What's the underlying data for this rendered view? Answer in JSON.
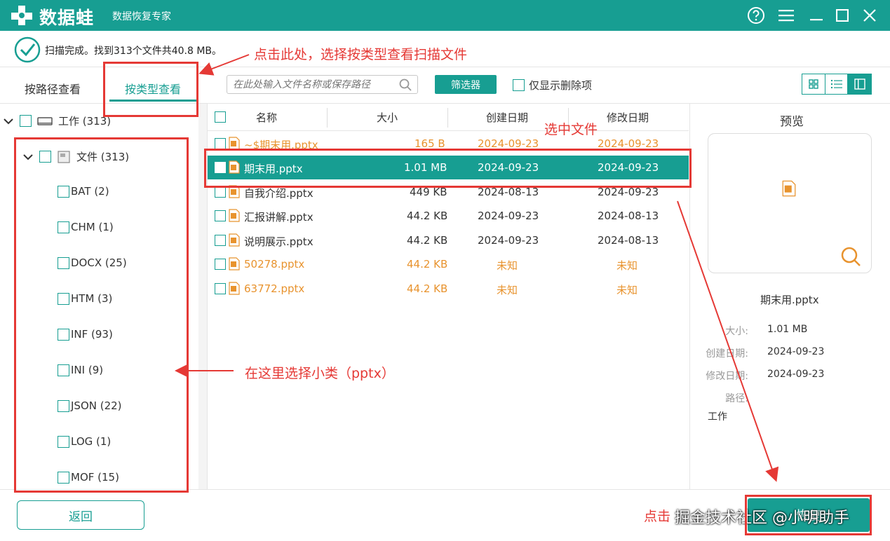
{
  "titlebar": {
    "app_name": "数据蛙",
    "subtitle": "数据恢复专家",
    "colors": {
      "brand": "#179e92"
    }
  },
  "status": {
    "text": "扫描完成。找到313个文件共40.8 MB。"
  },
  "tabs": [
    {
      "label": "按路径查看",
      "active": false
    },
    {
      "label": "按类型查看",
      "active": true
    }
  ],
  "search": {
    "placeholder": "在此处输入文件名称或保存路径"
  },
  "filter_label": "筛选器",
  "deleted_only_label": "仅显示删除项",
  "tree": {
    "root": "工作 (313)",
    "folder": "文件 (313)",
    "types": [
      "BAT (2)",
      "CHM (1)",
      "DOCX (25)",
      "HTM (3)",
      "INF (93)",
      "INI (9)",
      "JSON (22)",
      "LOG (1)",
      "MOF (15)"
    ]
  },
  "table": {
    "headers": {
      "name": "名称",
      "size": "大小",
      "created": "创建日期",
      "modified": "修改日期"
    },
    "rows": [
      {
        "name": "~$期末用.pptx",
        "size": "165  B",
        "created": "2024-09-23",
        "modified": "2024-09-23",
        "style": "orange"
      },
      {
        "name": "期末用.pptx",
        "size": "1.01 MB",
        "created": "2024-09-23",
        "modified": "2024-09-23",
        "style": "selected"
      },
      {
        "name": "自我介绍.pptx",
        "size": "449 KB",
        "created": "2024-08-13",
        "modified": "2024-09-23",
        "style": "normal"
      },
      {
        "name": "汇报讲解.pptx",
        "size": "44.2 KB",
        "created": "2024-09-23",
        "modified": "2024-08-13",
        "style": "normal"
      },
      {
        "name": "说明展示.pptx",
        "size": "44.2 KB",
        "created": "2024-09-23",
        "modified": "2024-08-13",
        "style": "normal"
      },
      {
        "name": "50278.pptx",
        "size": "44.2 KB",
        "created": "未知",
        "modified": "未知",
        "style": "orange"
      },
      {
        "name": "63772.pptx",
        "size": "44.2 KB",
        "created": "未知",
        "modified": "未知",
        "style": "orange"
      }
    ]
  },
  "preview": {
    "title": "预览",
    "file_name": "期末用.pptx",
    "size_label": "大小:",
    "size": "1.01 MB",
    "created_label": "创建日期:",
    "created": "2024-09-23",
    "modified_label": "修改日期:",
    "modified": "2024-09-23",
    "path_label": "路径:",
    "path": "工作"
  },
  "buttons": {
    "back": "返回",
    "recover": "恢复"
  },
  "annotations": {
    "tab_hint": "点击此处，选择按类型查看扫描文件",
    "select_file": "选中文件",
    "select_type": "在这里选择小类（pptx）",
    "click_recover": "点击"
  },
  "watermark": "掘金技术社区 @小明助手"
}
